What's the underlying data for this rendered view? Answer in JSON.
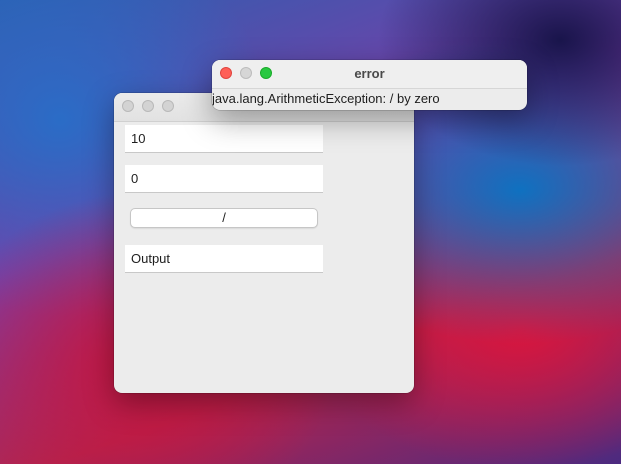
{
  "main_window": {
    "input_a": "10",
    "input_b": "0",
    "operator_button_label": "/",
    "output_value": "Output"
  },
  "error_dialog": {
    "title": "error",
    "message": "java.lang.ArithmeticException: / by zero"
  }
}
